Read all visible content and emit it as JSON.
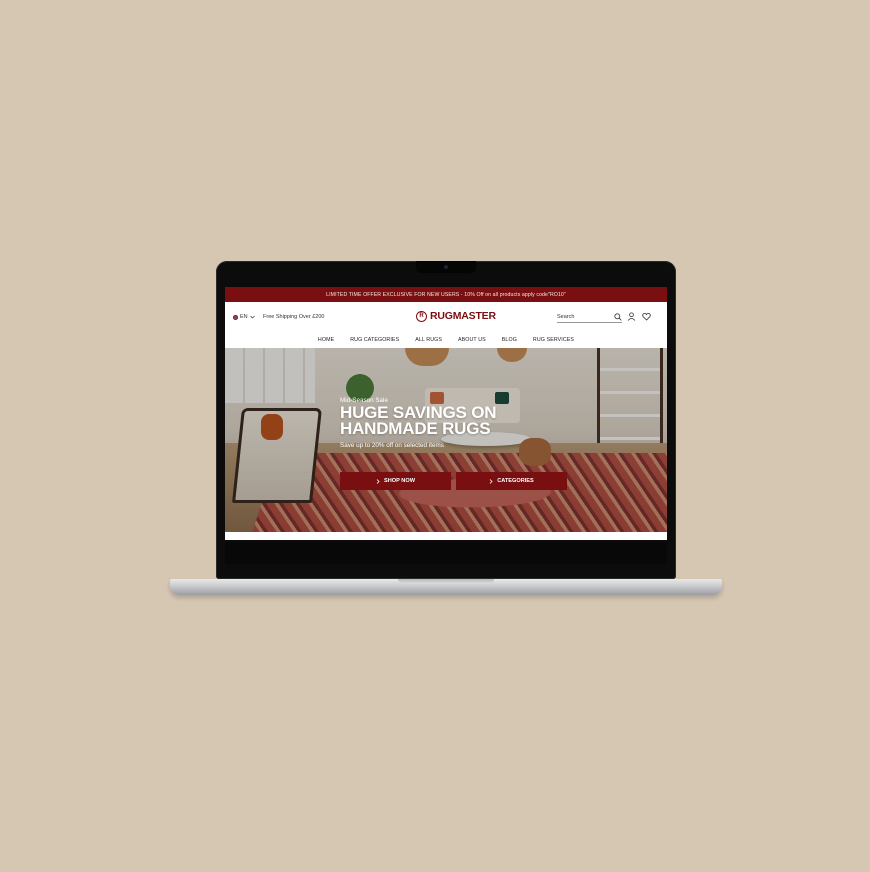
{
  "promo_bar": {
    "text": "LIMITED TIME OFFER EXCLUSIVE FOR NEW USERS - 10% Off on all products apply code\"RO10\""
  },
  "header": {
    "language": "EN",
    "shipping_note": "Free Shipping Over £200",
    "logo_text": "RUGMASTER",
    "logo_mark": "R",
    "search": {
      "placeholder": "Search"
    },
    "icons": [
      "search-icon",
      "user-icon",
      "heart-icon"
    ]
  },
  "nav": {
    "items": [
      "HOME",
      "RUG CATEGORIES",
      "ALL RUGS",
      "ABOUT US",
      "BLOG",
      "RUG SERVICES"
    ]
  },
  "hero": {
    "eyebrow": "Mid-Season Sale",
    "headline_line1": "HUGE SAVINGS ON",
    "headline_line2": "HANDMADE RUGS",
    "subline": "Save up to 20% off on selected items",
    "buttons": [
      {
        "label": "SHOP NOW",
        "icon": "chevron-right-icon"
      },
      {
        "label": "CATEGORIES",
        "icon": "chevron-right-icon"
      }
    ]
  },
  "colors": {
    "brand": "#7a0f12",
    "backdrop": "#d6c7b3"
  }
}
